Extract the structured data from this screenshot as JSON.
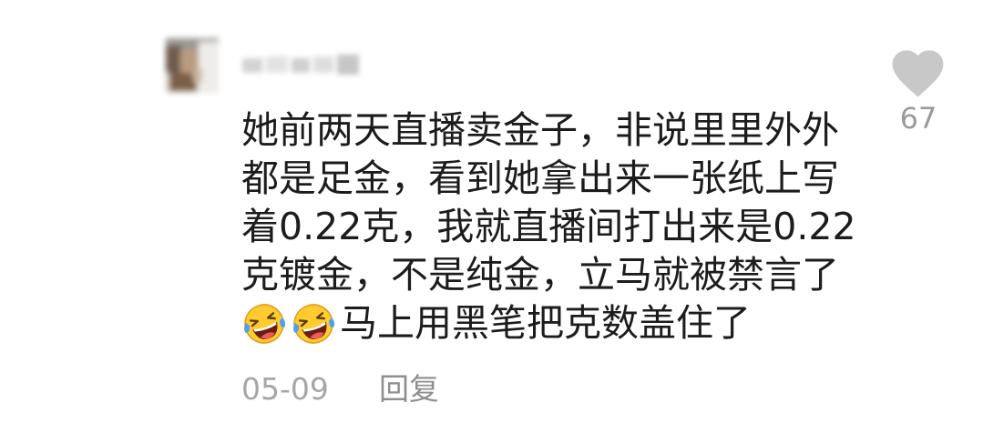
{
  "comment": {
    "lines": [
      "她前两天直播卖金子，非说里里外外",
      "都是足金，看到她拿出来一张纸上写",
      "着0.22克，我就直播间打出来是0.22",
      "克镀金，不是纯金，立马就被禁言了"
    ],
    "last_line": {
      "emojis": [
        "laughing-crying-emoji-icon",
        "laughing-crying-emoji-icon"
      ],
      "text": "马上用黑笔把克数盖住了"
    },
    "date": "05-09",
    "reply_label": "回复"
  },
  "like": {
    "icon": "heart-icon",
    "count": "67"
  },
  "avatar": {
    "icon": "avatar-blurred"
  },
  "colors": {
    "text": "#1c1c1c",
    "meta": "#a6a6a6",
    "reply": "#8e8e8e",
    "heart": "#c8c8c8",
    "count": "#9a9a9a",
    "bg": "#ffffff"
  }
}
